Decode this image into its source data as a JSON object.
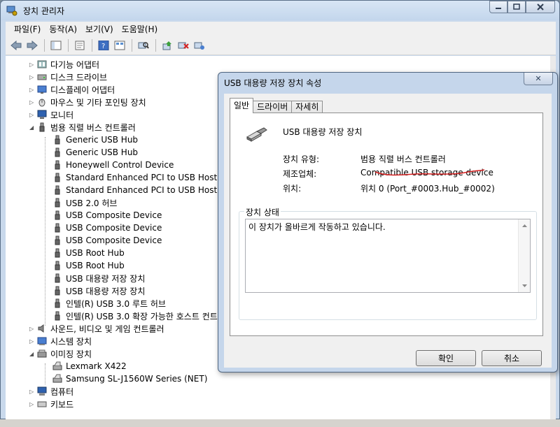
{
  "window": {
    "title": "장치 관리자",
    "menu": [
      "파일(F)",
      "동작(A)",
      "보기(V)",
      "도움말(H)"
    ],
    "toolbar_icons": [
      "back-icon",
      "forward-icon",
      "show-hide-tree-icon",
      "properties-icon",
      "help-icon",
      "view-icon",
      "scan-hardware-icon",
      "update-driver-icon",
      "disable-device-icon",
      "uninstall-icon"
    ]
  },
  "tree": {
    "categories": [
      {
        "label": "다기능 어댑터",
        "icon": "multifunction-adapter-icon"
      },
      {
        "label": "디스크 드라이브",
        "icon": "disk-drive-icon"
      },
      {
        "label": "디스플레이 어댑터",
        "icon": "display-adapter-icon"
      },
      {
        "label": "마우스 및 기타 포인팅 장치",
        "icon": "mouse-icon"
      },
      {
        "label": "모니터",
        "icon": "monitor-icon"
      },
      {
        "label": "범용 직렬 버스 컨트롤러",
        "icon": "usb-icon"
      }
    ],
    "usb_children": [
      "Generic USB Hub",
      "Generic USB Hub",
      "Honeywell Control Device",
      "Standard Enhanced PCI to USB Host Cor",
      "Standard Enhanced PCI to USB Host Cor",
      "USB 2.0 허브",
      "USB Composite Device",
      "USB Composite Device",
      "USB Composite Device",
      "USB Root Hub",
      "USB Root Hub",
      "USB 대용량 저장 장치",
      "USB 대용량 저장 장치",
      "인텔(R) USB 3.0 루트 허브",
      "인텔(R) USB 3.0 확장 가능한 호스트 컨트"
    ],
    "after_usb": [
      {
        "label": "사운드, 비디오 및 게임 컨트롤러",
        "icon": "sound-icon"
      },
      {
        "label": "시스템 장치",
        "icon": "system-device-icon"
      },
      {
        "label": "이미징 장치",
        "icon": "imaging-device-icon"
      }
    ],
    "imaging_children": [
      "Lexmark X422",
      "Samsung SL-J1560W Series (NET)"
    ],
    "last": [
      {
        "label": "컴퓨터",
        "icon": "computer-icon"
      },
      {
        "label": "키보드",
        "icon": "keyboard-icon"
      }
    ]
  },
  "dialog": {
    "title": "USB 대용량 저장 장치 속성",
    "tabs": [
      "일반",
      "드라이버",
      "자세히"
    ],
    "device_name": "USB 대용량 저장 장치",
    "props": [
      {
        "label": "장치 유형:",
        "value": "범용 직렬 버스 컨트롤러"
      },
      {
        "label": "제조업체:",
        "value": "Compatible USB storage device"
      },
      {
        "label": "위치:",
        "value": "위치 0 (Port_#0003.Hub_#0002)"
      }
    ],
    "status_legend": "장치 상태",
    "status_text": "이 장치가 올바르게 작동하고 있습니다.",
    "ok_label": "확인",
    "cancel_label": "취소",
    "close_glyph": "✕"
  },
  "colors": {
    "annotation_red": "#d42020",
    "titlebar": "#c9d9ec"
  }
}
